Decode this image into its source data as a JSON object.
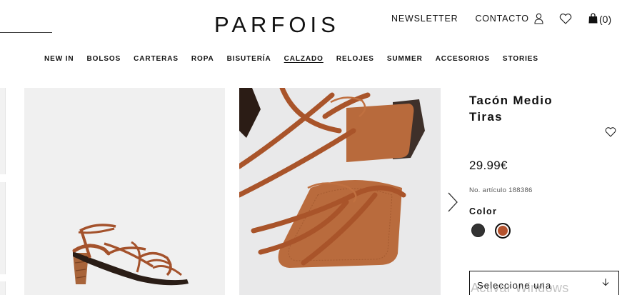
{
  "header": {
    "logo_text": "PARFOIS",
    "links": {
      "newsletter": "NEWSLETTER",
      "contact": "CONTACTO"
    },
    "cart_count": "(0)"
  },
  "nav": {
    "items": [
      {
        "label": "NEW IN"
      },
      {
        "label": "BOLSOS"
      },
      {
        "label": "CARTERAS"
      },
      {
        "label": "ROPA"
      },
      {
        "label": "BISUTERÍA"
      },
      {
        "label": "CALZADO",
        "active": true
      },
      {
        "label": "RELOJES"
      },
      {
        "label": "SUMMER"
      },
      {
        "label": "ACCESORIOS"
      },
      {
        "label": "STORIES"
      }
    ]
  },
  "product": {
    "title_line1": "Tacón Medio",
    "title_line2": "Tiras",
    "price": "29.99€",
    "article": "No. artículo 188386",
    "color_label": "Color",
    "colors": [
      {
        "name": "black",
        "hex": "#333333"
      },
      {
        "name": "brown",
        "hex": "#b5532e",
        "selected": true
      }
    ],
    "size_placeholder": "Seleccione una"
  },
  "overlay": {
    "watermark": "Activar Windows"
  }
}
